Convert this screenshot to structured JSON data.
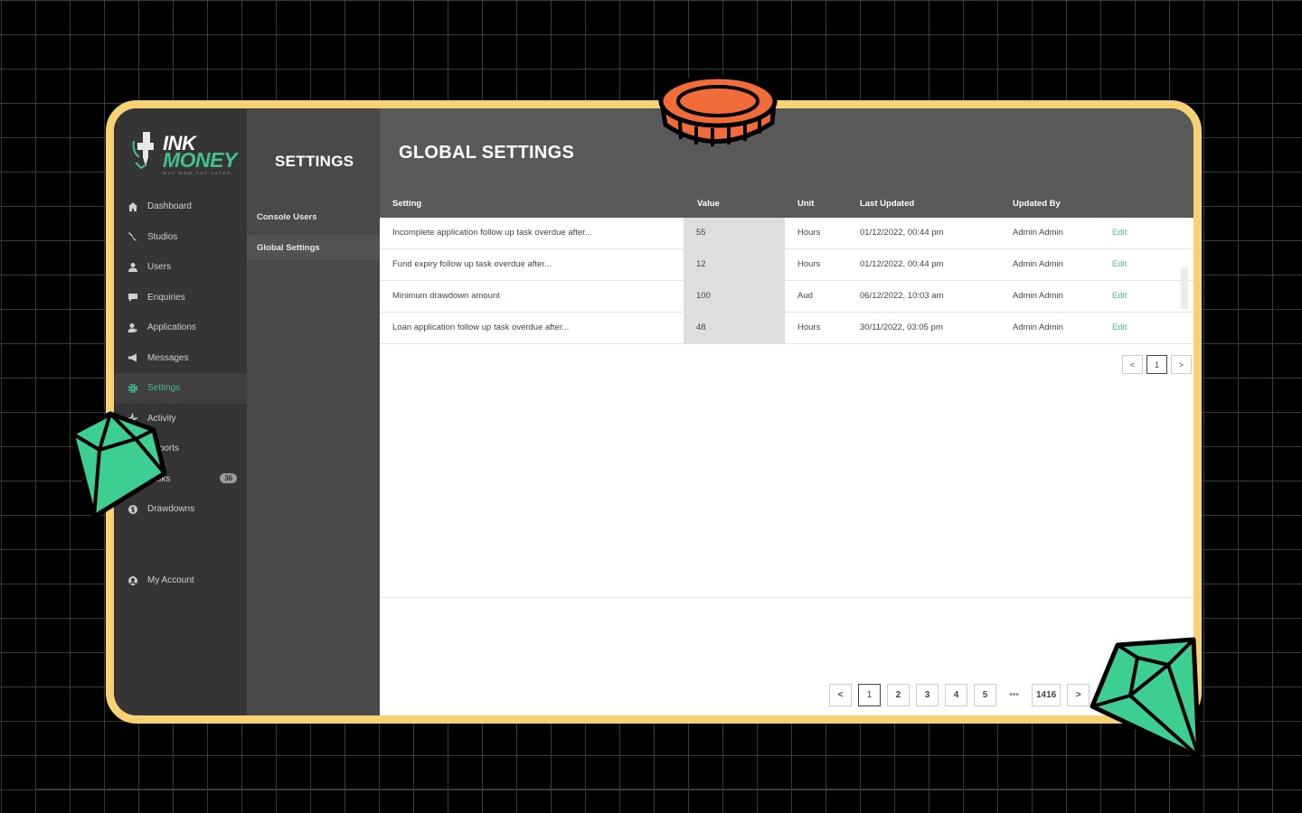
{
  "brand": {
    "line1": "INK",
    "line2": "MONEY",
    "tagline": "BUY NOW PAY LATER"
  },
  "nav": {
    "items": [
      {
        "label": "Dashboard",
        "icon": "home-icon"
      },
      {
        "label": "Studios",
        "icon": "tattoo-machine-icon"
      },
      {
        "label": "Users",
        "icon": "user-icon"
      },
      {
        "label": "Enquiries",
        "icon": "chat-icon"
      },
      {
        "label": "Applications",
        "icon": "user-edit-icon"
      },
      {
        "label": "Messages",
        "icon": "megaphone-icon"
      },
      {
        "label": "Settings",
        "icon": "gear-icon",
        "active": true
      },
      {
        "label": "Activity",
        "icon": "activity-icon"
      },
      {
        "label": "Reports",
        "icon": "report-icon"
      },
      {
        "label": "Tasks",
        "icon": "tasks-icon",
        "badge": "36"
      },
      {
        "label": "Drawdowns",
        "icon": "dollar-icon"
      }
    ],
    "account": {
      "label": "My Account",
      "icon": "account-icon"
    }
  },
  "subnav": {
    "title": "SETTINGS",
    "items": [
      {
        "label": "Console Users"
      },
      {
        "label": "Global Settings",
        "active": true
      }
    ]
  },
  "main": {
    "title": "GLOBAL SETTINGS",
    "columns": [
      "Setting",
      "Value",
      "Unit",
      "Last Updated",
      "Updated By"
    ],
    "rows": [
      {
        "setting": "Incomplete application follow up task overdue after...",
        "value": "55",
        "unit": "Hours",
        "updated": "01/12/2022, 00:44 pm",
        "by": "Admin Admin",
        "action": "Edit"
      },
      {
        "setting": "Fund expiry follow up task overdue after...",
        "value": "12",
        "unit": "Hours",
        "updated": "01/12/2022, 00:44 pm",
        "by": "Admin Admin",
        "action": "Edit"
      },
      {
        "setting": "Minimum drawdown amount",
        "value": "100",
        "unit": "Aud",
        "updated": "06/12/2022, 10:03 am",
        "by": "Admin Admin",
        "action": "Edit"
      },
      {
        "setting": "Loan application follow up task overdue after...",
        "value": "48",
        "unit": "Hours",
        "updated": "30/11/2022, 03:05 pm",
        "by": "Admin Admin",
        "action": "Edit"
      }
    ],
    "table_pager": {
      "prev": "<",
      "current": "1",
      "next": ">"
    },
    "bottom_pager": {
      "prev": "<",
      "pages": [
        "1",
        "2",
        "3",
        "4",
        "5"
      ],
      "ellipsis": "•••",
      "last": "1416",
      "next": ">"
    }
  },
  "colors": {
    "accent": "#3fc08e",
    "frame": "#f7d272",
    "coin": "#f26b3a",
    "gem": "#3dcf91"
  }
}
